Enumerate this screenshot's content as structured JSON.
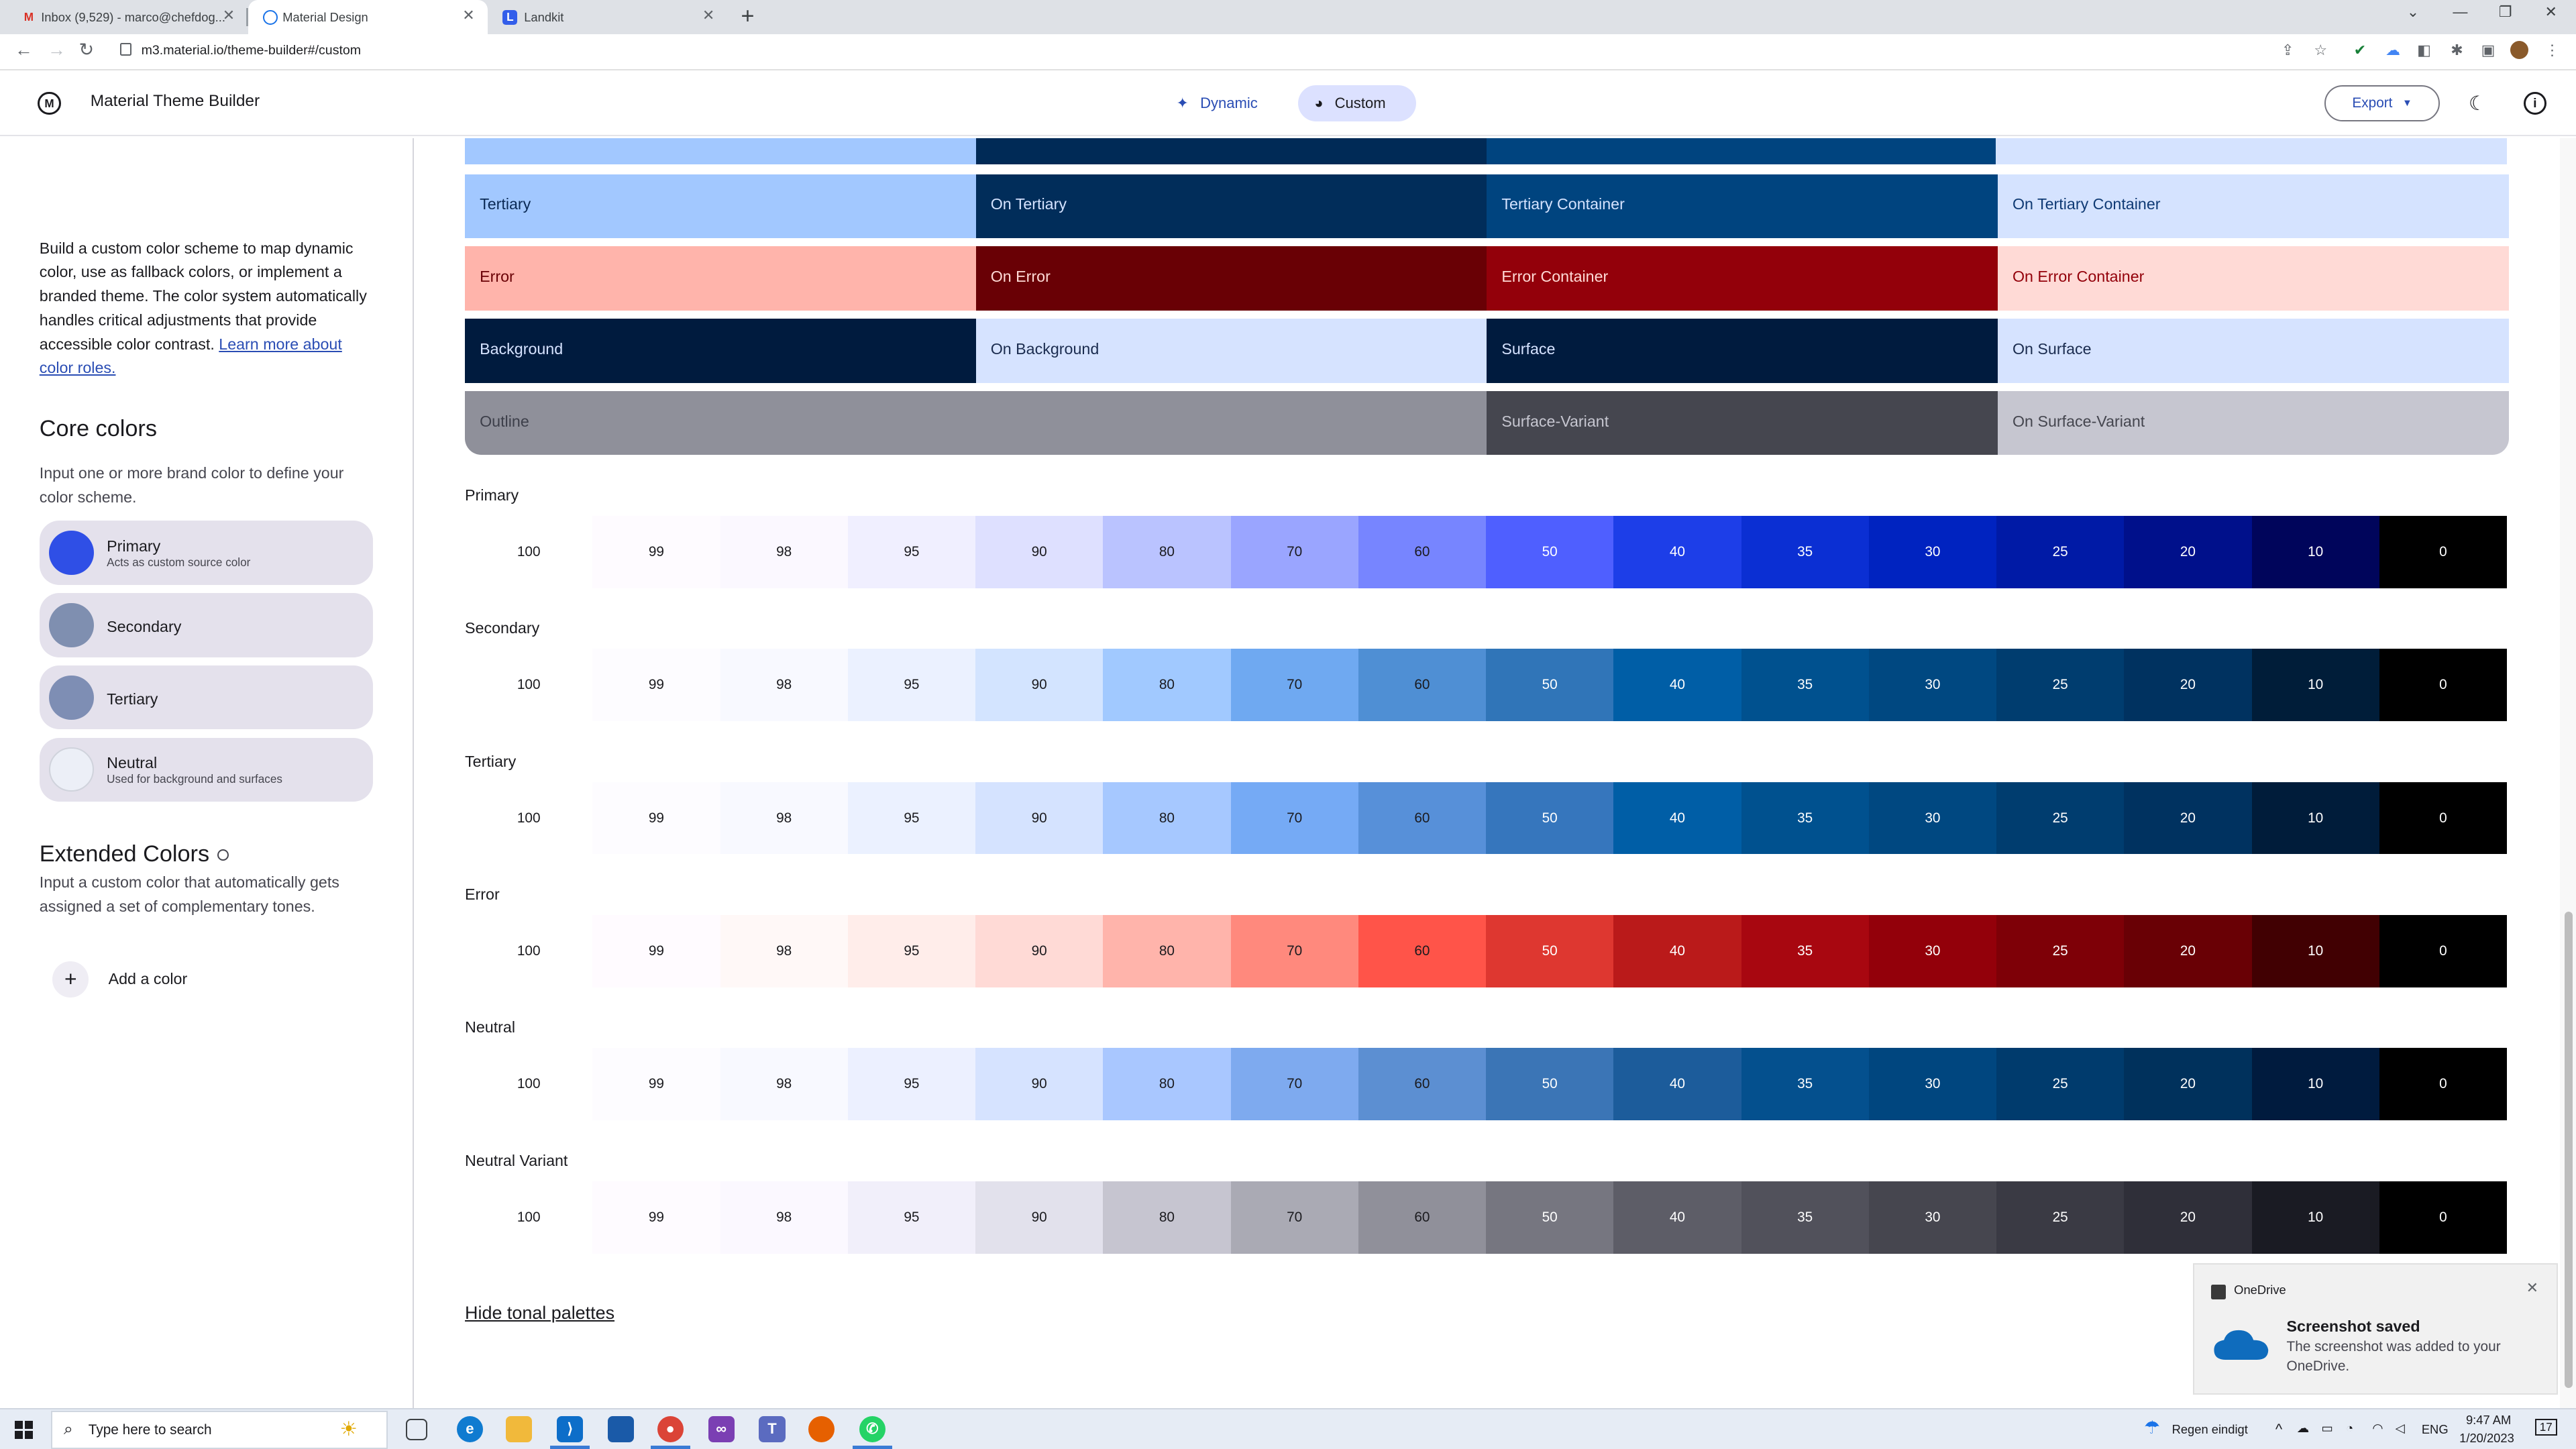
{
  "browser": {
    "tabs": [
      {
        "title": "Inbox (9,529) - marco@chefdog...",
        "icon": "gmail-icon",
        "active": false
      },
      {
        "title": "Material Design",
        "icon": "material-icon",
        "active": true
      },
      {
        "title": "Landkit",
        "icon": "landkit-icon",
        "active": false
      }
    ],
    "url": "m3.material.io/theme-builder#/custom"
  },
  "header": {
    "title": "Material Theme Builder",
    "dynamic_label": "Dynamic",
    "custom_label": "Custom",
    "export_label": "Export"
  },
  "sidebar": {
    "intro": "Build a custom color scheme to map dynamic color, use as fallback colors, or implement a branded theme. The color system automatically handles critical adjustments that provide accessible color contrast.",
    "learn_link": "Learn more about color roles.",
    "core_title": "Core colors",
    "core_sub": "Input one or more brand color to define your color scheme.",
    "core_colors": [
      {
        "name": "Primary",
        "desc": "Acts as custom source color",
        "color": "#2f4fe6"
      },
      {
        "name": "Secondary",
        "desc": "",
        "color": "#7f8fb0"
      },
      {
        "name": "Tertiary",
        "desc": "",
        "color": "#7e8eb4"
      },
      {
        "name": "Neutral",
        "desc": "Used for background and surfaces",
        "color": "#eceff7"
      }
    ],
    "extended_title": "Extended Colors",
    "extended_sub": "Input a custom color that automatically gets assigned a set of complementary tones.",
    "add_color": "Add a color"
  },
  "roles": [
    [
      {
        "label": "Tertiary",
        "bg": "#a2c8ff",
        "fg": "#0b2a55"
      },
      {
        "label": "On Tertiary",
        "bg": "#012d5a",
        "fg": "#d5e3ff"
      },
      {
        "label": "Tertiary Container",
        "bg": "#00447f",
        "fg": "#d5e3ff"
      },
      {
        "label": "On Tertiary Container",
        "bg": "#d5e3ff",
        "fg": "#0f3a74"
      }
    ],
    [
      {
        "label": "Error",
        "bg": "#ffb4ab",
        "fg": "#690005"
      },
      {
        "label": "On Error",
        "bg": "#690005",
        "fg": "#ffdad6"
      },
      {
        "label": "Error Container",
        "bg": "#93000a",
        "fg": "#ffdad6"
      },
      {
        "label": "On Error Container",
        "bg": "#ffdad6",
        "fg": "#93000a"
      }
    ],
    [
      {
        "label": "Background",
        "bg": "#001b3e",
        "fg": "#d6e3ff"
      },
      {
        "label": "On Background",
        "bg": "#d6e3ff",
        "fg": "#1b2c4f"
      },
      {
        "label": "Surface",
        "bg": "#001b3e",
        "fg": "#d6e3ff"
      },
      {
        "label": "On Surface",
        "bg": "#d6e3ff",
        "fg": "#1b2c4f"
      }
    ],
    [
      {
        "label": "Outline",
        "bg": "#8f909a",
        "fg": "#3d3f4a",
        "span": 2
      },
      {
        "label": "Surface-Variant",
        "bg": "#45464f",
        "fg": "#c6c6d0"
      },
      {
        "label": "On Surface-Variant",
        "bg": "#c6c6d0",
        "fg": "#45464f"
      }
    ]
  ],
  "tone_labels": [
    "100",
    "99",
    "98",
    "95",
    "90",
    "80",
    "70",
    "60",
    "50",
    "40",
    "35",
    "30",
    "25",
    "20",
    "10",
    "0"
  ],
  "palettes": [
    {
      "name": "Primary",
      "colors": [
        "#ffffff",
        "#fefbff",
        "#fbf8ff",
        "#f0efff",
        "#dee0ff",
        "#bac3ff",
        "#9aa5ff",
        "#7785ff",
        "#4f5fff",
        "#1d3ee8",
        "#0b2fd3",
        "#0023c0",
        "#001aa6",
        "#00108b",
        "#00055b",
        "#000000"
      ]
    },
    {
      "name": "Secondary",
      "colors": [
        "#ffffff",
        "#fdfcff",
        "#f8f9ff",
        "#ebf1ff",
        "#d3e4ff",
        "#a1c9ff",
        "#6fa9f1",
        "#4f8fd4",
        "#3075b8",
        "#005ea6",
        "#00518f",
        "#004881",
        "#003d6f",
        "#003260",
        "#001d39",
        "#000000"
      ]
    },
    {
      "name": "Tertiary",
      "colors": [
        "#ffffff",
        "#fdfcff",
        "#f8f9ff",
        "#ebf1ff",
        "#d5e3ff",
        "#a6c8ff",
        "#75aaf5",
        "#5790d9",
        "#3676bd",
        "#005ea6",
        "#00518f",
        "#004881",
        "#003d6f",
        "#003260",
        "#001c3a",
        "#000000"
      ]
    },
    {
      "name": "Error",
      "colors": [
        "#ffffff",
        "#fffbff",
        "#fff8f7",
        "#ffedea",
        "#ffdad6",
        "#ffb4ab",
        "#ff897d",
        "#ff5449",
        "#de3730",
        "#ba1a1a",
        "#a80710",
        "#93000a",
        "#7e0007",
        "#690005",
        "#410002",
        "#000000"
      ]
    },
    {
      "name": "Neutral",
      "colors": [
        "#ffffff",
        "#fdfcff",
        "#f8f9ff",
        "#ecf0ff",
        "#d6e3ff",
        "#a9c7ff",
        "#7eaaef",
        "#5c8fd2",
        "#3b75b6",
        "#1c5c9b",
        "#04508e",
        "#00467f",
        "#003b6d",
        "#00315c",
        "#001b3e",
        "#000000"
      ]
    },
    {
      "name": "Neutral Variant",
      "colors": [
        "#ffffff",
        "#fefbff",
        "#fbf8ff",
        "#f1effa",
        "#e2e1ec",
        "#c6c5d0",
        "#aaaab4",
        "#90909a",
        "#767680",
        "#5d5d67",
        "#51515b",
        "#46464f",
        "#3a3a44",
        "#2f2f39",
        "#1a1b23",
        "#000000"
      ]
    }
  ],
  "hide_palettes": "Hide tonal palettes",
  "toast": {
    "app": "OneDrive",
    "title": "Screenshot saved",
    "message": "The screenshot was added to your OneDrive."
  },
  "taskbar": {
    "search_placeholder": "Type here to search",
    "weather": "Regen eindigt",
    "lang": "ENG",
    "time": "9:47 AM",
    "date": "1/20/2023",
    "notifications": "17"
  }
}
